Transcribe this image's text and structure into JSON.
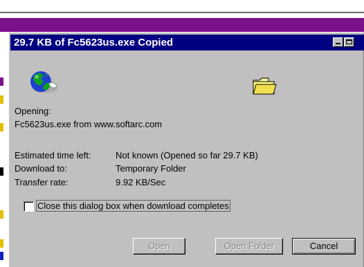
{
  "dialog": {
    "title": "29.7 KB of Fc5623us.exe Copied",
    "opening_label": "Opening:",
    "file_source": "Fc5623us.exe from www.softarc.com",
    "est_time_label": "Estimated time left:",
    "est_time_value": "Not known (Opened so far 29.7 KB)",
    "download_to_label": "Download to:",
    "download_to_value": "Temporary Folder",
    "transfer_rate_label": "Transfer rate:",
    "transfer_rate_value": "9.92 KB/Sec",
    "close_checkbox_label": "Close this dialog box when download completes",
    "close_checkbox_checked": false,
    "open_button": "Open",
    "open_folder_button": "Open Folder",
    "cancel_button": "Cancel"
  },
  "icons": {
    "globe": "globe-icon",
    "folder": "folder-icon",
    "minimize": "minimize-icon",
    "maximize": "maximize-icon"
  },
  "colors": {
    "titlebar": "#000080",
    "face": "#c0c0c0",
    "background_window_bar": "#7b0f8c"
  }
}
